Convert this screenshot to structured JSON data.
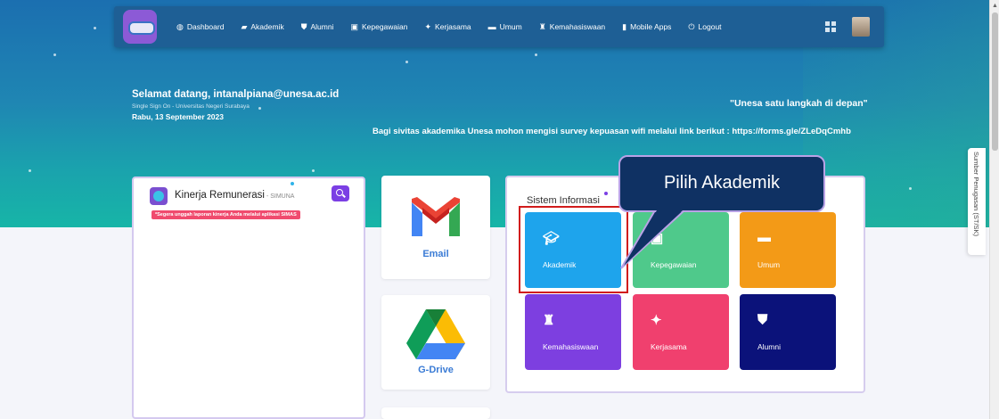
{
  "nav": {
    "items": [
      {
        "label": "Dashboard",
        "icon": "dashboard-icon",
        "glyph": "◍"
      },
      {
        "label": "Akademik",
        "icon": "graduation-cap-icon",
        "glyph": "▰"
      },
      {
        "label": "Alumni",
        "icon": "user-tie-icon",
        "glyph": "⛊"
      },
      {
        "label": "Kepegawaian",
        "icon": "id-card-icon",
        "glyph": "▣"
      },
      {
        "label": "Kerjasama",
        "icon": "handshake-icon",
        "glyph": "✦"
      },
      {
        "label": "Umum",
        "icon": "comment-icon",
        "glyph": "▬"
      },
      {
        "label": "Kemahasiswaan",
        "icon": "trophy-icon",
        "glyph": "♜"
      },
      {
        "label": "Mobile Apps",
        "icon": "mobile-icon",
        "glyph": "▮"
      },
      {
        "label": "Logout",
        "icon": "power-icon",
        "glyph": "⏻"
      }
    ]
  },
  "hero": {
    "welcome": "Selamat datang, intanalpiana@unesa.ac.id",
    "sso": "Single Sign On - Universitas Negeri Surabaya",
    "date": "Rabu, 13 September 2023",
    "motto": "\"Unesa satu langkah di depan\"",
    "survey": "Bagi sivitas akademika Unesa mohon mengisi survey kepuasan wifi melalui link berikut : https://forms.gle/ZLeDqCmhb"
  },
  "side_tab": {
    "label": "Sumber Penugasan (ST/SK)"
  },
  "kinerja": {
    "title": "Kinerja Remunerasi",
    "subtitle": " - SIMUNA",
    "alert": "*Segera unggah laporan kinerja Anda melalui aplikasi SIMAS"
  },
  "apps": {
    "email_label": "Email",
    "gdrive_label": "G-Drive"
  },
  "sysinfo": {
    "title": "Sistem Informasi",
    "tiles": [
      {
        "label": "Akademik",
        "icon": "graduation-cap-icon",
        "color": "#1ea4ec"
      },
      {
        "label": "Kepegawaian",
        "icon": "id-card-icon",
        "color": "#4fc98b"
      },
      {
        "label": "Umum",
        "icon": "comment-icon",
        "color": "#f39a17"
      },
      {
        "label": "Kemahasiswaan",
        "icon": "trophy-icon",
        "color": "#7d3fe0"
      },
      {
        "label": "Kerjasama",
        "icon": "handshake-icon",
        "color": "#f0406e"
      },
      {
        "label": "Alumni",
        "icon": "user-tie-icon",
        "color": "#0b127a"
      }
    ]
  },
  "callout": {
    "text": "Pilih Akademik"
  },
  "colors": {
    "nav_bg": "#1e5f95",
    "callout_bg": "#0f3163",
    "highlight": "#d11c1c",
    "accent_purple": "#7b3fe4"
  }
}
